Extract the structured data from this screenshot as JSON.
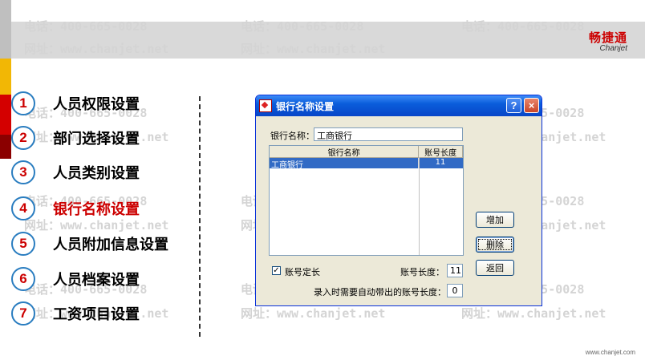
{
  "watermark": {
    "phone": "电话：400-665-0028",
    "web": "网址：www.chanjet.net"
  },
  "logo": {
    "cn": "畅捷通",
    "en": "Chanjet"
  },
  "site_footer": "www.chanjet.com",
  "menu": [
    {
      "num": "1",
      "label": "人员权限设置"
    },
    {
      "num": "2",
      "label": "部门选择设置"
    },
    {
      "num": "3",
      "label": "人员类别设置"
    },
    {
      "num": "4",
      "label": "银行名称设置"
    },
    {
      "num": "5",
      "label": "人员附加信息设置"
    },
    {
      "num": "6",
      "label": "人员档案设置"
    },
    {
      "num": "7",
      "label": "工资项目设置"
    }
  ],
  "active_menu_index": 3,
  "dialog": {
    "title": "银行名称设置",
    "help_label": "?",
    "close_label": "×",
    "bank_name_label": "银行名称：",
    "bank_name_value": "工商银行",
    "columns": [
      "银行名称",
      "账号长度"
    ],
    "rows": [
      {
        "name": "工商银行",
        "length": "11"
      }
    ],
    "add_label": "增加",
    "delete_label": "删除",
    "back_label": "返回",
    "fixed_length_label": "账号定长",
    "fixed_length_checked": "✓",
    "account_length_label": "账号长度：",
    "account_length_value": "11",
    "auto_length_label": "录入时需要自动带出的账号长度：",
    "auto_length_value": "0"
  },
  "colors": {
    "accent_red": "#cc0000",
    "circle_border": "#2a7dc0",
    "titlebar_blue": "#0a5ddb",
    "selection_blue": "#316ac5"
  }
}
